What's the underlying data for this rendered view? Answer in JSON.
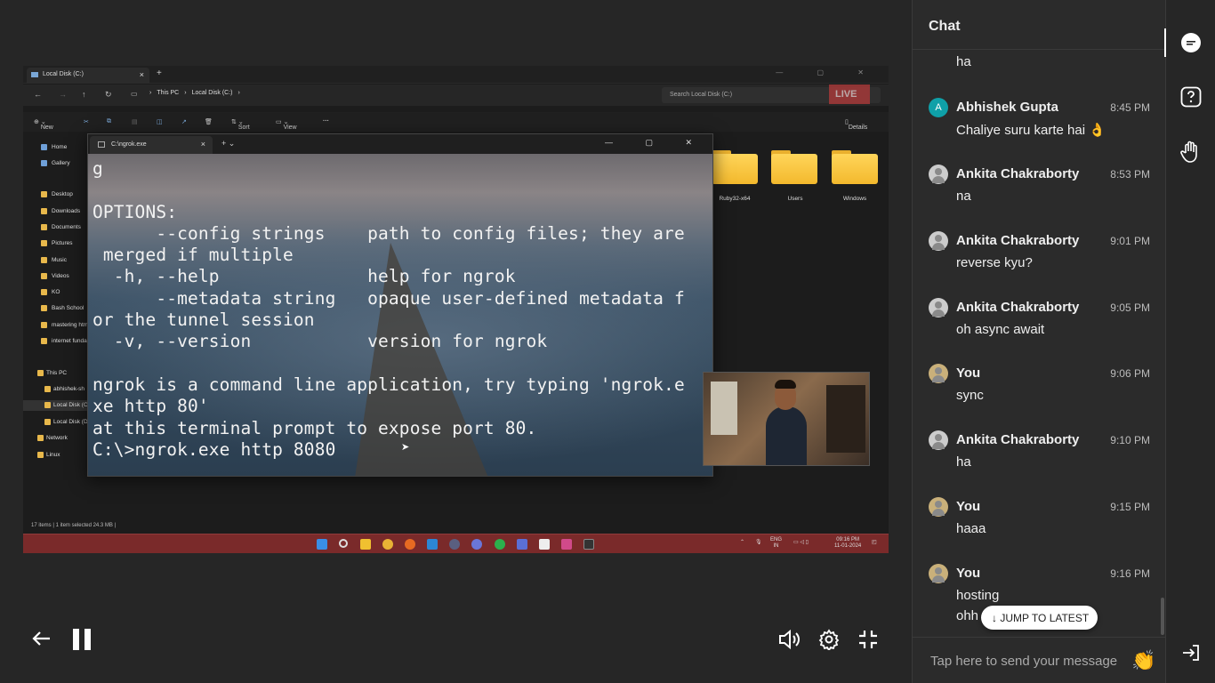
{
  "video": {
    "live_badge": "LIVE",
    "explorer": {
      "tab_title": "Local Disk (C:)",
      "breadcrumb": [
        "This PC",
        "Local Disk (C:)"
      ],
      "search_placeholder": "Search Local Disk (C:)",
      "toolbar": {
        "new": "New",
        "sort": "Sort",
        "view": "View",
        "details": "Details"
      },
      "sidebar": [
        "Home",
        "Gallery",
        "Desktop",
        "Downloads",
        "Documents",
        "Pictures",
        "Music",
        "Videos",
        "KO",
        "Bash School",
        "mastering htm",
        "internet funda",
        "This PC",
        "abhishek-sh",
        "Local Disk (C",
        "Local Disk (D",
        "Network",
        "Linux"
      ],
      "folders": [
        "Ruby32-x64",
        "Users",
        "Windows"
      ],
      "status": "17 items  |  1 item selected  24.3 MB  |"
    },
    "terminal": {
      "tab_title": "C:\\ngrok.exe",
      "lines": [
        "g",
        "",
        "OPTIONS:",
        "      --config strings    path to config files; they are",
        " merged if multiple",
        "  -h, --help              help for ngrok",
        "      --metadata string   opaque user-defined metadata f",
        "or the tunnel session",
        "  -v, --version           version for ngrok",
        "",
        "ngrok is a command line application, try typing 'ngrok.e",
        "xe http 80'",
        "at this terminal prompt to expose port 80.",
        "C:\\>ngrok.exe http 8080"
      ]
    },
    "taskbar": {
      "lang": "ENG",
      "region": "IN",
      "time": "09:16 PM",
      "date": "11-01-2024"
    }
  },
  "chat": {
    "title": "Chat",
    "first_text": "ha",
    "messages": [
      {
        "name": "Abhishek Gupta",
        "time": "8:45 PM",
        "text": "Chaliye suru karte hai 👌",
        "avatar": "A"
      },
      {
        "name": "Ankita Chakraborty",
        "time": "8:53 PM",
        "text": "na"
      },
      {
        "name": "Ankita Chakraborty",
        "time": "9:01 PM",
        "text": "reverse kyu?"
      },
      {
        "name": "Ankita Chakraborty",
        "time": "9:05 PM",
        "text": "oh async await"
      },
      {
        "name": "You",
        "time": "9:06 PM",
        "text": "sync"
      },
      {
        "name": "Ankita Chakraborty",
        "time": "9:10 PM",
        "text": "ha"
      },
      {
        "name": "You",
        "time": "9:15 PM",
        "text": "haaa"
      },
      {
        "name": "You",
        "time": "9:16 PM",
        "text": "hosting",
        "text2": "ohh"
      }
    ],
    "jump_label": "JUMP TO LATEST",
    "input_placeholder": "Tap here to send your message",
    "wave_emoji": "👏"
  }
}
